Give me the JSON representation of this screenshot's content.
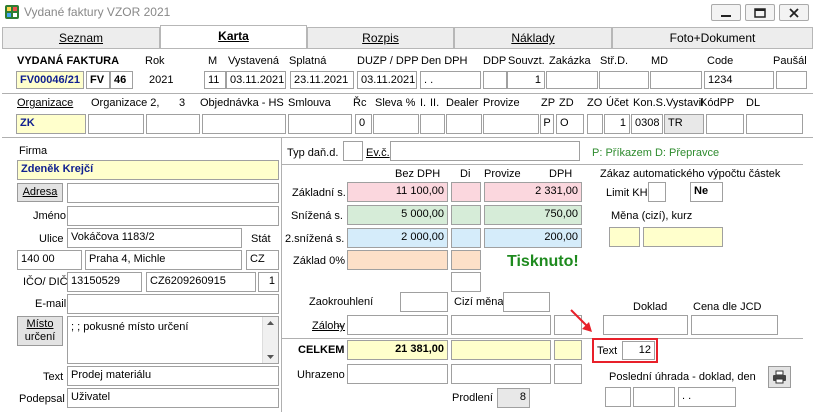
{
  "window": {
    "title": "Vydané faktury VZOR  2021"
  },
  "tabs": [
    {
      "label": "Seznam"
    },
    {
      "label": "Karta"
    },
    {
      "label": "Rozpis"
    },
    {
      "label": "Náklady"
    },
    {
      "label": "Foto+Dokument"
    }
  ],
  "header": {
    "labels": {
      "doc_type": "VYDANÁ FAKTURA",
      "rok": "Rok",
      "m": "M",
      "vystavena": "Vystavená",
      "splatna": "Splatná",
      "duzp": "DUZP / DPP",
      "den_dph": "Den DPH",
      "ddp": "DDP",
      "souvzt": "Souvzt.",
      "zakazka": "Zakázka",
      "strd": "Stř.D.",
      "md": "MD",
      "code": "Code",
      "pausal": "Paušál"
    },
    "values": {
      "doc_number": "FV00046/21",
      "series": "FV",
      "series_no": "46",
      "rok": "2021",
      "m": "11",
      "vystavena": "03.11.2021",
      "splatna": "23.11.2021",
      "duzp": "03.11.2021",
      "den_dph": ". .",
      "souvzt": "1",
      "code": "1234"
    }
  },
  "row2": {
    "labels": {
      "organizace": "Organizace",
      "organizace23": "Organizace 2,",
      "three": "3",
      "objednavka": "Objednávka - HS",
      "smlouva": "Smlouva",
      "rc": "Řc",
      "sleva": "Sleva %",
      "i": "I.",
      "ii": "II.",
      "dealer": "Dealer",
      "provize": "Provize",
      "zp": "ZP",
      "zd": "ZD",
      "zo": "ZO",
      "ucet": "Účet",
      "kons": "Kon.S.",
      "vystavil": "Vystavil",
      "kodpp": "KódPP",
      "dl": "DL"
    },
    "values": {
      "organizace": "ZK",
      "rc": "0",
      "zp": "P",
      "zd": "O",
      "zo": "1",
      "ucet": "0308",
      "vystavil": "TR"
    }
  },
  "firma": {
    "labels": {
      "firma": "Firma",
      "adresa": "Adresa",
      "jmeno": "Jméno",
      "ulice": "Ulice",
      "stat": "Stát",
      "ico": "IČO/ DIČ",
      "email": "E-mail",
      "misto1": "Místo",
      "misto2": "určení",
      "text": "Text",
      "podepsal": "Podepsal"
    },
    "values": {
      "firma": "Zdeněk Krejčí",
      "ulice": "Vokáčova 1183/2",
      "psc": "140  00",
      "mesto": "Praha 4, Michle",
      "stat": "CZ",
      "ico": "13150529",
      "dic": "CZ6209260915",
      "ico_n": "1",
      "misto": "; ; pokusné místo určení",
      "text": "Prodej materiálu",
      "podepsal": "Uživatel"
    }
  },
  "tax": {
    "labels": {
      "typ": "Typ daň.d.",
      "evc": "Ev.č.",
      "legend": "P: Příkazem  D: Přepravce",
      "bez_dph": "Bez DPH",
      "di": "Di",
      "provize": "Provize",
      "dph": "DPH",
      "zakladni": "Základní s.",
      "snizena": "Snížená s.",
      "snizena2": "2.snížená s.",
      "zaklad0": "Základ 0%",
      "zakaz": "Zákaz automatického výpočtu částek",
      "limit": "Limit KH",
      "mena": "Měna (cizí), kurz",
      "zaokrouhleni": "Zaokrouhlení",
      "cizi_mena": "Cizí měna",
      "zalohy": "Zálohy",
      "celkem": "CELKEM",
      "uhrazeno": "Uhrazeno",
      "prodleni": "Prodlení",
      "doklad": "Doklad",
      "cena_jcd": "Cena dle JCD",
      "text": "Text",
      "posledni": "Poslední úhrada - doklad, den"
    },
    "values": {
      "zakladni_bez": "11 100,00",
      "zakladni_dph": "2 331,00",
      "snizena_bez": "5 000,00",
      "snizena_dph": "750,00",
      "snizena2_bez": "2 000,00",
      "snizena2_dph": "200,00",
      "tisknuto": "Tisknuto!",
      "limit": "Ne",
      "celkem": "21 381,00",
      "prodleni": "8",
      "text": "12",
      "posledni_date": ". ."
    }
  },
  "colors": {
    "highlight_red": "#e8202a",
    "tisknuto_green": "#1e8a1e",
    "legend_green": "#2e8b2e"
  }
}
